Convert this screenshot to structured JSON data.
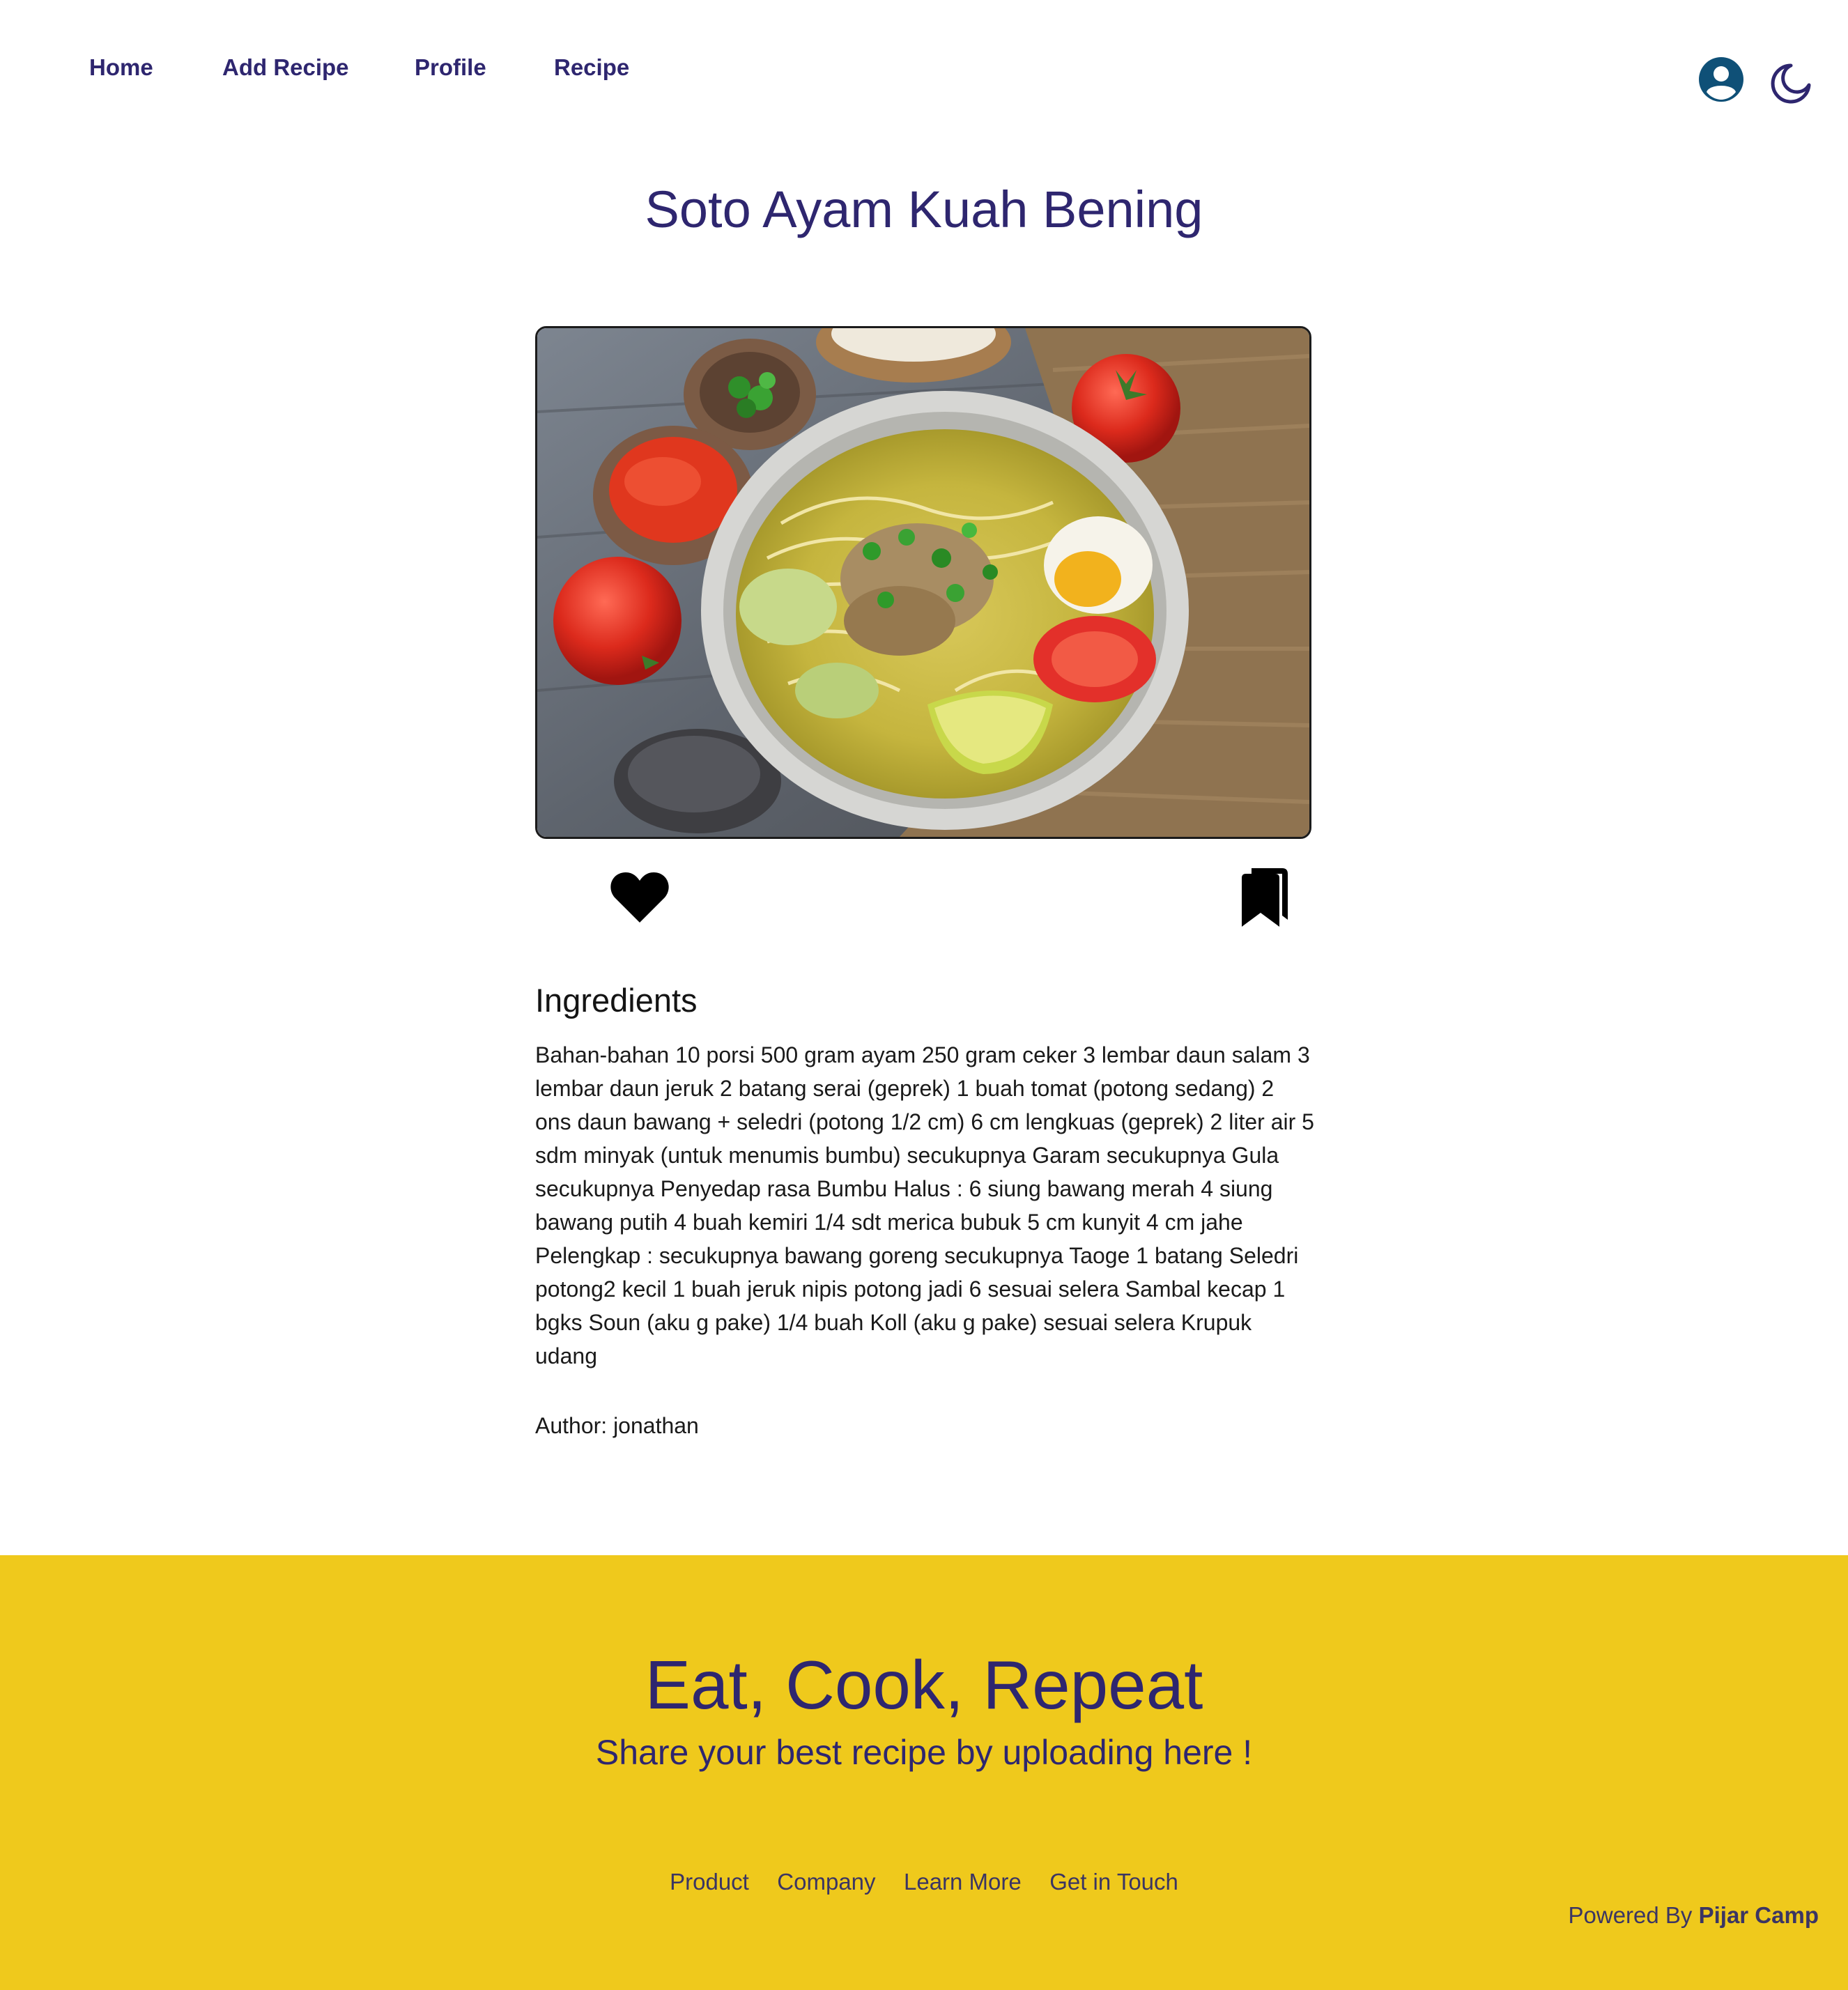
{
  "nav": {
    "links": [
      "Home",
      "Add Recipe",
      "Profile",
      "Recipe"
    ]
  },
  "icons": {
    "profile": "user-circle-icon",
    "theme": "moon-icon",
    "like": "heart-icon",
    "save": "bookmarks-icon"
  },
  "recipe": {
    "title": "Soto Ayam Kuah Bening",
    "ingredients_heading": "Ingredients",
    "ingredients": "Bahan-bahan 10 porsi 500 gram ayam 250 gram ceker 3 lembar daun salam 3 lembar daun jeruk 2 batang serai (geprek) 1 buah tomat (potong sedang) 2 ons daun bawang + seledri (potong 1/2 cm) 6 cm lengkuas (geprek) 2 liter air 5 sdm minyak (untuk menumis bumbu) secukupnya Garam secukupnya Gula secukupnya Penyedap rasa Bumbu Halus : 6 siung bawang merah 4 siung bawang putih 4 buah kemiri 1/4 sdt merica bubuk 5 cm kunyit 4 cm jahe Pelengkap : secukupnya bawang goreng secukupnya Taoge 1 batang Seledri potong2 kecil 1 buah jeruk nipis potong jadi 6 sesuai selera Sambal kecap 1 bgks Soun (aku g pake) 1/4 buah Koll (aku g pake) sesuai selera Krupuk udang",
    "author": "Author: jonathan"
  },
  "footer": {
    "title": "Eat, Cook, Repeat",
    "subtitle": "Share your best recipe by uploading here !",
    "links": [
      "Product",
      "Company",
      "Learn More",
      "Get in Touch"
    ],
    "powered_prefix": "Powered By ",
    "powered_brand": "Pijar Camp"
  },
  "colors": {
    "primary": "#2e266f",
    "footer_bg": "#efc91c",
    "avatar": "#0f5077"
  }
}
